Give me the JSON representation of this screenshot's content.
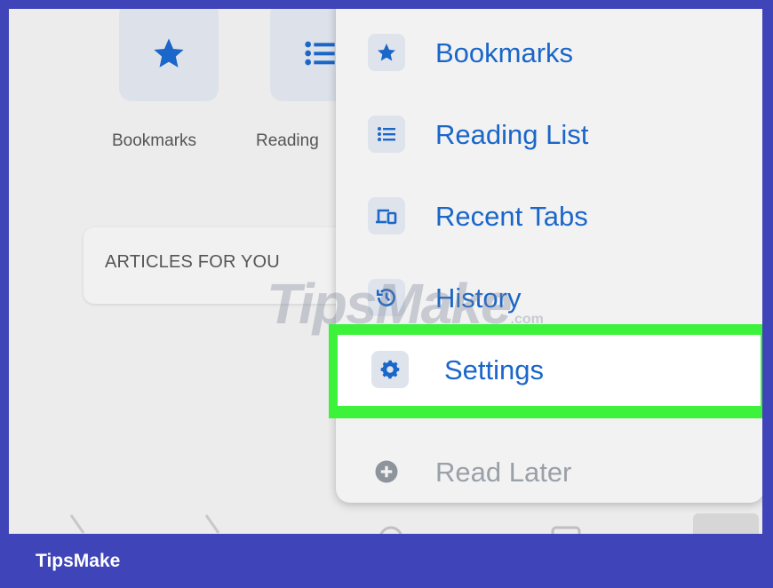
{
  "background": {
    "tiles": [
      {
        "label": "Bookmarks",
        "icon": "star-icon"
      },
      {
        "label": "Reading",
        "icon": "list-icon"
      }
    ],
    "articles_label": "ARTICLES FOR YOU"
  },
  "menu": {
    "items": [
      {
        "label": "Bookmarks",
        "icon": "star-icon"
      },
      {
        "label": "Reading List",
        "icon": "list-icon"
      },
      {
        "label": "Recent Tabs",
        "icon": "devices-icon"
      },
      {
        "label": "History",
        "icon": "history-icon"
      },
      {
        "label": "Settings",
        "icon": "gear-icon"
      },
      {
        "label": "Read Later",
        "icon": "plus-circle-icon"
      }
    ]
  },
  "watermark": {
    "text": "TipsMake",
    "suffix": ".com"
  },
  "footer": {
    "brand": "TipsMake"
  },
  "colors": {
    "accent": "#1a66c9",
    "highlight": "#3cf23a",
    "frame": "#3f44b8"
  }
}
